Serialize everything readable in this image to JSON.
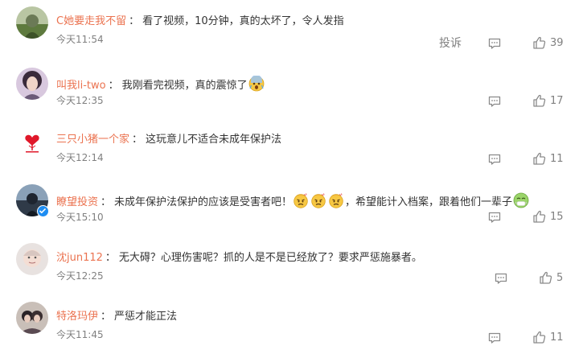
{
  "comments": [
    {
      "username": "C她要走我不留",
      "colon": "：",
      "text": "看了视频，10分钟，真的太坏了，令人发指",
      "time": "今天11:54",
      "report_label": "投诉",
      "likes": "39",
      "avatar_icon": "avatar-photo-icon"
    },
    {
      "username": "叫我li-two",
      "colon": "：",
      "text": "我刚看完视频，真的震惊了",
      "emoji": "shocked-face-emoji",
      "time": "今天12:35",
      "likes": "17",
      "avatar_icon": "avatar-photo-icon"
    },
    {
      "username": "三只小猪一个家",
      "colon": "：",
      "text": "这玩意儿不适合未成年保护法",
      "time": "今天12:14",
      "likes": "11",
      "avatar_icon": "avatar-red-heart-tree-icon"
    },
    {
      "username": "瞭望投资",
      "colon": "：",
      "text_before": "未成年保护法保护的应该是受害者吧！",
      "text_middle": "，希望能计入档案，跟着他们一辈子",
      "emoji_first": "angry-face-emoji",
      "emoji_last": "sick-face-emoji",
      "time": "今天15:10",
      "likes": "15",
      "avatar_icon": "avatar-photo-icon",
      "verified_icon": "verified-badge-icon"
    },
    {
      "username": "沈jun112",
      "colon": "：",
      "text": "无大碍？心理伤害呢？抓的人是不是已经放了？要求严惩施暴者。",
      "time": "今天12:25",
      "likes": "5",
      "avatar_icon": "avatar-photo-icon"
    },
    {
      "username": "特洛玛伊",
      "colon": "：",
      "text": "严惩才能正法",
      "time": "今天11:45",
      "likes": "11",
      "avatar_icon": "avatar-photo-icon"
    }
  ],
  "colors": {
    "username": "#eb7350",
    "text": "#333333",
    "meta": "#808080",
    "verified": "#1e8df2"
  },
  "icons": {
    "comment": "comment-icon",
    "like": "thumbs-up-icon"
  }
}
